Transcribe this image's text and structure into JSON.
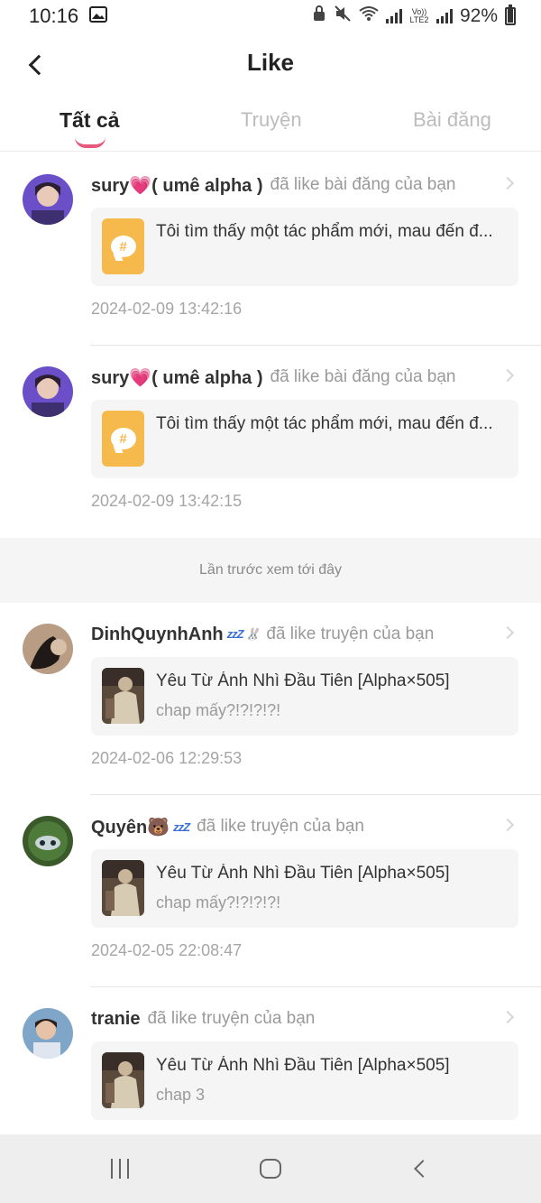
{
  "status_bar": {
    "time": "10:16",
    "network_label": "Vo)) LTE2",
    "battery": "92%"
  },
  "header": {
    "title": "Like"
  },
  "tabs": [
    {
      "label": "Tất cả",
      "active": true
    },
    {
      "label": "Truyện",
      "active": false
    },
    {
      "label": "Bài đăng",
      "active": false
    }
  ],
  "feed": {
    "items": [
      {
        "username": "sury💗( umê alpha )",
        "action": "đã like bài đăng của bạn",
        "card_type": "post",
        "card_title": "Tôi tìm thấy một tác phẩm mới, mau đến đ...",
        "card_subtitle": "",
        "timestamp": "2024-02-09 13:42:16"
      },
      {
        "username": "sury💗( umê alpha )",
        "action": "đã like bài đăng của bạn",
        "card_type": "post",
        "card_title": "Tôi tìm thấy một tác phẩm mới, mau đến đ...",
        "card_subtitle": "",
        "timestamp": "2024-02-09 13:42:15"
      }
    ],
    "divider_text": "Lần trước xem tới đây",
    "older_items": [
      {
        "username": "DinhQuynhAnh",
        "username_deco": "zzZ 🐰",
        "action": "đã like truyện của bạn",
        "card_type": "story",
        "card_title": "Yêu Từ Ánh Nhì Đầu Tiên [Alpha×505]",
        "card_subtitle": "chap mấy?!?!?!?!",
        "timestamp": "2024-02-06 12:29:53"
      },
      {
        "username": "Quyên🐻",
        "username_deco": "zzZ",
        "action": "đã like truyện của bạn",
        "card_type": "story",
        "card_title": "Yêu Từ Ánh Nhì Đầu Tiên [Alpha×505]",
        "card_subtitle": "chap mấy?!?!?!?!",
        "timestamp": "2024-02-05 22:08:47"
      },
      {
        "username": "tranie",
        "username_deco": "",
        "action": "đã like truyện của bạn",
        "card_type": "story",
        "card_title": "Yêu Từ Ánh Nhì Đầu Tiên [Alpha×505]",
        "card_subtitle": "chap 3",
        "timestamp": ""
      }
    ]
  },
  "icons": {
    "back": "chevron-left-icon",
    "post": "hashtag-chat-icon",
    "row_chevron": "chevron-right-icon"
  },
  "colors": {
    "accent_underline": "#e8587a",
    "post_icon": "#f6b94c",
    "card_bg": "#f5f5f5",
    "band_bg": "#f5f5f5"
  }
}
